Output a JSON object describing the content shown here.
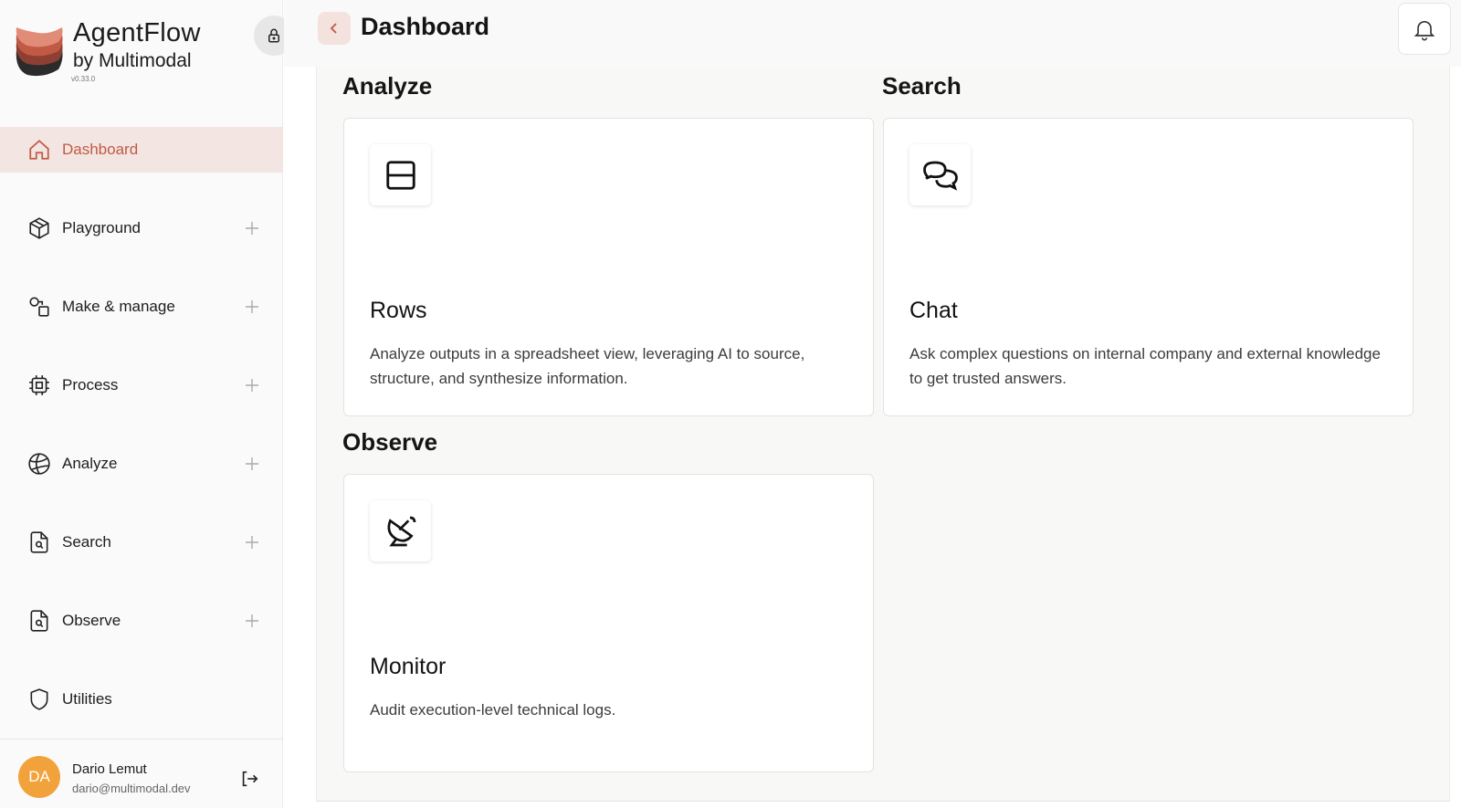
{
  "brand": {
    "name": "AgentFlow",
    "sub": "by Multimodal",
    "version": "v0.33.0"
  },
  "sidebar": {
    "items": [
      {
        "label": "Dashboard",
        "icon": "home-icon",
        "active": true,
        "expandable": false
      },
      {
        "label": "Playground",
        "icon": "cube-icon",
        "active": false,
        "expandable": true
      },
      {
        "label": "Make & manage",
        "icon": "shapes-icon",
        "active": false,
        "expandable": true
      },
      {
        "label": "Process",
        "icon": "chip-icon",
        "active": false,
        "expandable": true
      },
      {
        "label": "Analyze",
        "icon": "ball-icon",
        "active": false,
        "expandable": true
      },
      {
        "label": "Search",
        "icon": "file-search-icon",
        "active": false,
        "expandable": true
      },
      {
        "label": "Observe",
        "icon": "file-search-icon",
        "active": false,
        "expandable": true
      },
      {
        "label": "Utilities",
        "icon": "shield-icon",
        "active": false,
        "expandable": false
      }
    ]
  },
  "user": {
    "initials": "DA",
    "name": "Dario Lemut",
    "email": "dario@multimodal.dev"
  },
  "header": {
    "title": "Dashboard"
  },
  "sections": {
    "analyze": {
      "title": "Analyze",
      "card": {
        "title": "Rows",
        "icon": "rows-icon",
        "description": "Analyze outputs in a spreadsheet view, leveraging AI to source, structure, and synthesize information."
      }
    },
    "search": {
      "title": "Search",
      "card": {
        "title": "Chat",
        "icon": "chat-bubbles-icon",
        "description": "Ask complex questions on internal company and external knowledge to get trusted answers."
      }
    },
    "observe": {
      "title": "Observe",
      "card": {
        "title": "Monitor",
        "icon": "satellite-dish-icon",
        "description": "Audit execution-level technical logs."
      }
    }
  },
  "colors": {
    "accent": "#c05a45",
    "active_bg": "#f3e5e2",
    "avatar": "#f2a23a"
  }
}
